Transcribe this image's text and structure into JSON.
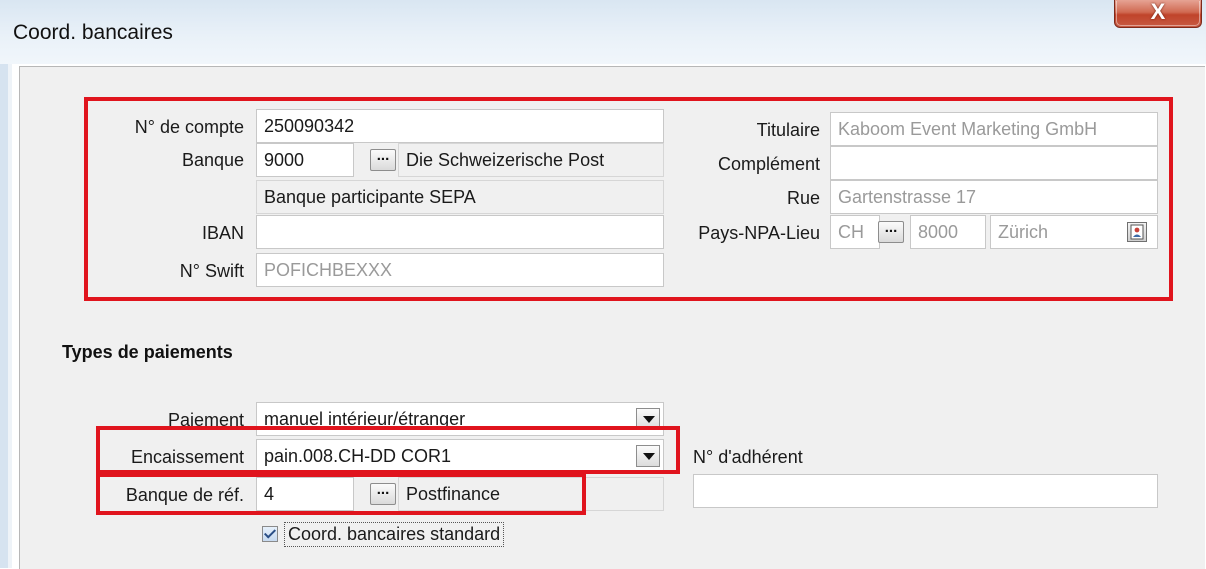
{
  "window": {
    "title": "Coord. bancaires",
    "close_label": "X"
  },
  "bank": {
    "account_label": "N° de compte",
    "account_value": "250090342",
    "bank_label": "Banque",
    "bank_code": "9000",
    "bank_name": "Die Schweizerische Post",
    "sepa_text": "Banque participante SEPA",
    "iban_label": "IBAN",
    "iban_value": "",
    "swift_label": "N° Swift",
    "swift_value": "POFICHBEXXX",
    "browse_label": "..."
  },
  "holder": {
    "titulaire_label": "Titulaire",
    "titulaire_value": "Kaboom Event Marketing GmbH",
    "complement_label": "Complément",
    "complement_value": "",
    "rue_label": "Rue",
    "rue_value": "Gartenstrasse 17",
    "pays_label": "Pays-NPA-Lieu",
    "country": "CH",
    "npa": "8000",
    "lieu": "Zürich",
    "browse_label": "..."
  },
  "payment": {
    "section_title": "Types de paiements",
    "paiement_label": "Paiement",
    "paiement_value": "manuel intérieur/étranger",
    "encaissement_label": "Encaissement",
    "encaissement_value": "pain.008.CH-DD COR1",
    "adherent_label": "N° d'adhérent",
    "adherent_value": "",
    "ref_bank_label": "Banque de réf.",
    "ref_bank_code": "4",
    "ref_bank_name": "Postfinance",
    "browse_label": "...",
    "standard_label": "Coord. bancaires standard",
    "standard_checked": true
  },
  "colors": {
    "highlight": "#e0141d",
    "close_button": "#c0442b",
    "titlebar": "#dce8f3",
    "panel": "#f0f0f0"
  }
}
